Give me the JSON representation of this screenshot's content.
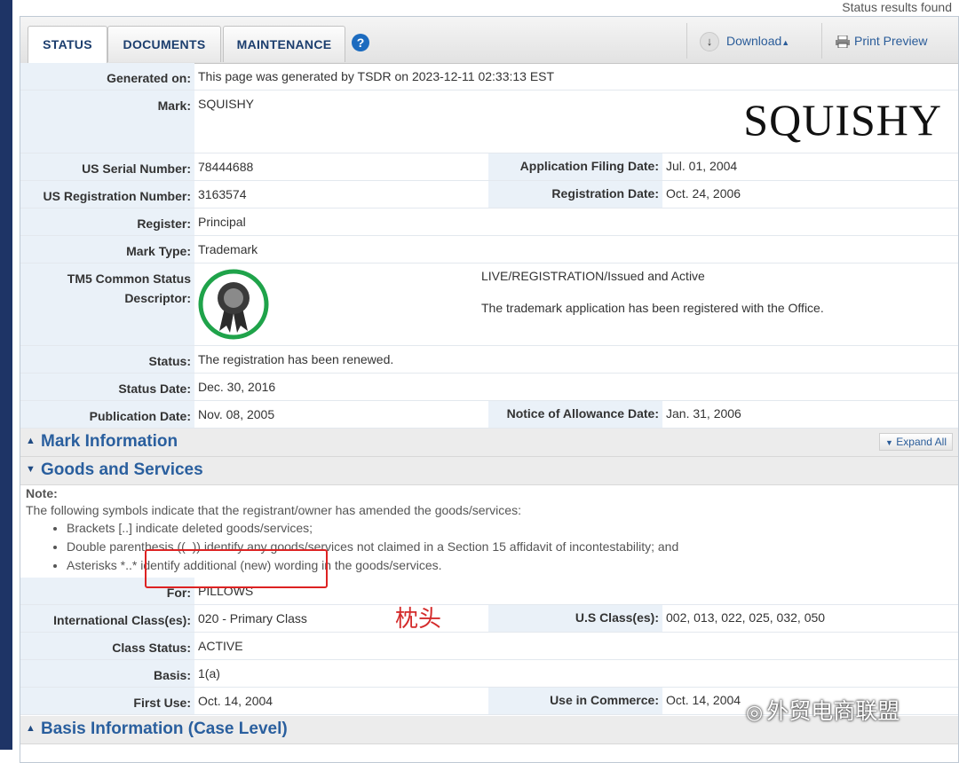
{
  "top_note": "Status results found",
  "tabs": [
    {
      "label": "STATUS",
      "active": true
    },
    {
      "label": "DOCUMENTS",
      "active": false
    },
    {
      "label": "MAINTENANCE",
      "active": false
    }
  ],
  "toolbar": {
    "help_icon": "question-circle-icon",
    "download_label": "Download",
    "print_label": "Print Preview"
  },
  "status": {
    "generated_on_label": "Generated on:",
    "generated_on_value": "This page was generated by TSDR on 2023-12-11 02:33:13 EST",
    "mark_label": "Mark:",
    "mark_value": "SQUISHY",
    "mark_image_text": "SQUISHY",
    "serial_label": "US Serial Number:",
    "serial_value": "78444688",
    "filing_date_label": "Application Filing Date:",
    "filing_date_value": "Jul. 01, 2004",
    "reg_number_label": "US Registration Number:",
    "reg_number_value": "3163574",
    "reg_date_label": "Registration Date:",
    "reg_date_value": "Oct. 24, 2006",
    "register_label": "Register:",
    "register_value": "Principal",
    "mark_type_label": "Mark Type:",
    "mark_type_value": "Trademark",
    "tm5_label_1": "TM5 Common Status",
    "tm5_label_2": "Descriptor:",
    "tm5_status": "LIVE/REGISTRATION/Issued and Active",
    "tm5_desc": "The trademark application has been registered with the Office.",
    "status_label": "Status:",
    "status_value": "The registration has been renewed.",
    "status_date_label": "Status Date:",
    "status_date_value": "Dec. 30, 2016",
    "pub_date_label": "Publication Date:",
    "pub_date_value": "Nov. 08, 2005",
    "allowance_label": "Notice of Allowance Date:",
    "allowance_value": "Jan. 31, 2006"
  },
  "sections": {
    "mark_info": "Mark Information",
    "expand_all": "Expand All",
    "goods": "Goods and Services",
    "basis": "Basis Information (Case Level)"
  },
  "goods": {
    "note_label": "Note:",
    "note_text": "The following symbols indicate that the registrant/owner has amended the goods/services:",
    "bullets": [
      "Brackets [..] indicate deleted goods/services;",
      "Double parenthesis ((..)) identify any goods/services not claimed in a Section 15 affidavit of incontestability; and",
      "Asterisks *..* identify additional (new) wording in the goods/services."
    ],
    "for_label": "For:",
    "for_value": "PILLOWS",
    "intl_class_label": "International Class(es):",
    "intl_class_value": "020 - Primary Class",
    "us_class_label": "U.S Class(es):",
    "us_class_value": "002, 013, 022, 025, 032, 050",
    "class_status_label": "Class Status:",
    "class_status_value": "ACTIVE",
    "basis_label": "Basis:",
    "basis_value": "1(a)",
    "first_use_label": "First Use:",
    "first_use_value": "Oct. 14, 2004",
    "use_commerce_label": "Use in Commerce:",
    "use_commerce_value": "Oct. 14, 2004"
  },
  "annotation": {
    "text": "枕头",
    "color": "#d42b2b"
  },
  "watermark": {
    "text": "外贸电商联盟",
    "icon": "wechat-icon"
  },
  "colors": {
    "accent": "#2a5f9e",
    "label_bg": "#eaf1f8",
    "seal_ring": "#1fa34a"
  }
}
